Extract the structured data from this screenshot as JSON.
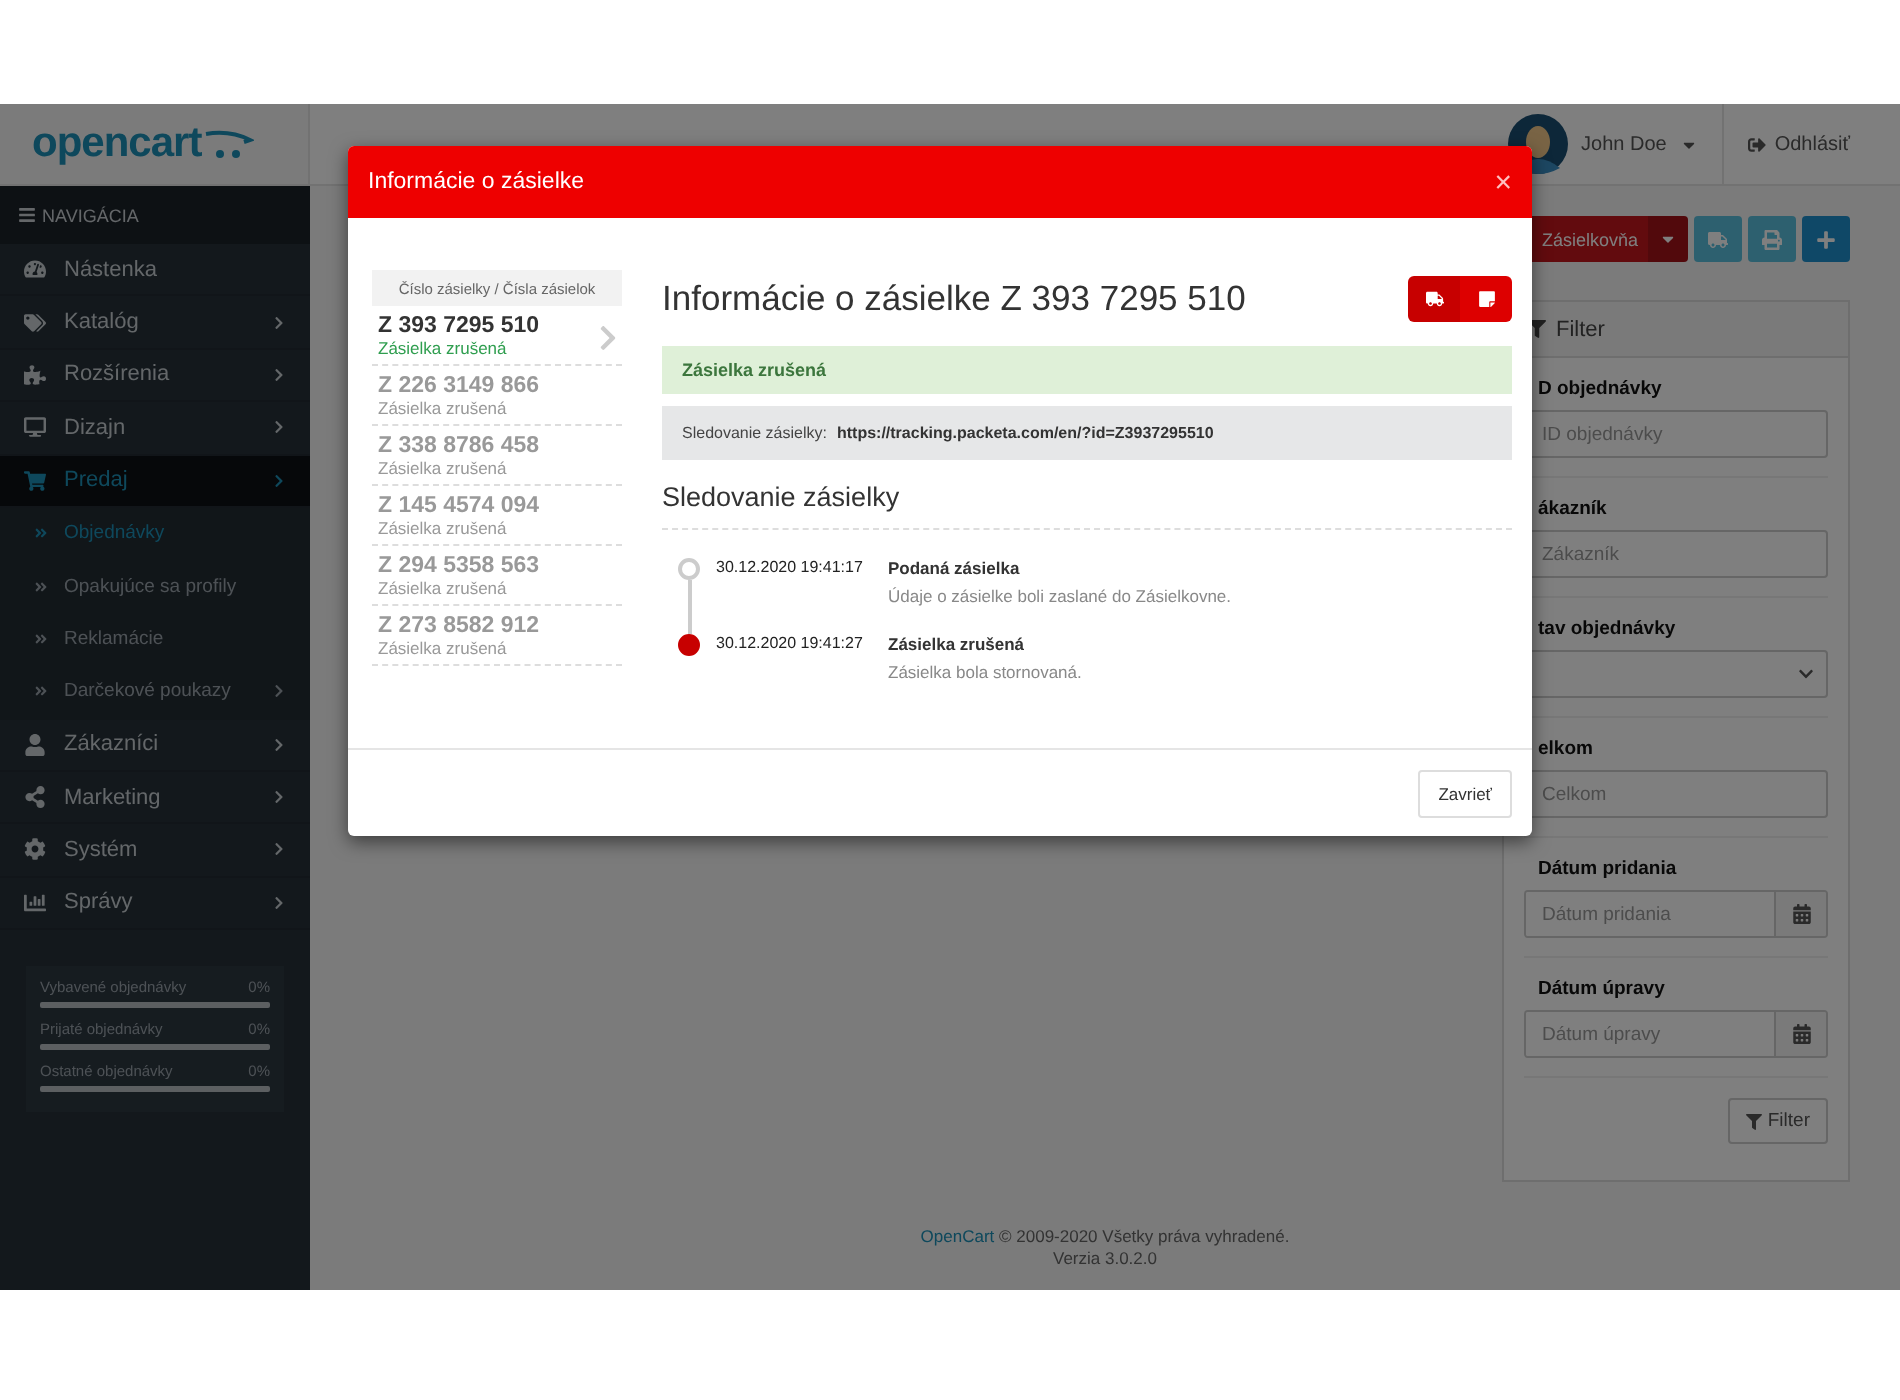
{
  "header": {
    "logo": "opencart",
    "user": "John Doe",
    "logout": "Odhlásiť"
  },
  "sidebar": {
    "title": "NAVIGÁCIA",
    "items": [
      {
        "label": "Nástenka",
        "submenu": false,
        "selected": false
      },
      {
        "label": "Katalóg",
        "submenu": true,
        "selected": false
      },
      {
        "label": "Rozšírenia",
        "submenu": true,
        "selected": false
      },
      {
        "label": "Dizajn",
        "submenu": true,
        "selected": false
      },
      {
        "label": "Predaj",
        "submenu": true,
        "selected": true,
        "expanded": true,
        "children": [
          {
            "label": "Objednávky",
            "submenu": false,
            "selected": true
          },
          {
            "label": "Opakujúce sa profily",
            "submenu": false,
            "selected": false
          },
          {
            "label": "Reklamácie",
            "submenu": false,
            "selected": false
          },
          {
            "label": "Darčekové poukazy",
            "submenu": true,
            "selected": false
          }
        ]
      },
      {
        "label": "Zákazníci",
        "submenu": true,
        "selected": false
      },
      {
        "label": "Marketing",
        "submenu": true,
        "selected": false
      },
      {
        "label": "Systém",
        "submenu": true,
        "selected": false
      },
      {
        "label": "Správy",
        "submenu": true,
        "selected": false
      }
    ],
    "stats": [
      {
        "label": "Vybavené objednávky",
        "value": "0%",
        "level": 0
      },
      {
        "label": "Prijaté objednávky",
        "value": "0%",
        "level": 0
      },
      {
        "label": "Ostatné objednávky",
        "value": "0%",
        "level": 0
      }
    ]
  },
  "toolbar": {
    "primary": "Zásielkovňa"
  },
  "filter": {
    "title": "Filter",
    "fields": [
      {
        "kind": "text",
        "label": "D objednávky",
        "placeholder": "ID objednávky"
      },
      {
        "kind": "text",
        "label": "ákazník",
        "placeholder": "Zákazník"
      },
      {
        "kind": "select",
        "label": "tav objednávky"
      },
      {
        "kind": "text",
        "label": "elkom",
        "placeholder": "Celkom"
      },
      {
        "kind": "date",
        "label": "Dátum pridania",
        "placeholder": "Dátum pridania"
      },
      {
        "kind": "date",
        "label": "Dátum úpravy",
        "placeholder": "Dátum úpravy"
      }
    ],
    "button": "Filter"
  },
  "footer": {
    "link": "OpenCart",
    "text": "© 2009-2020 Všetky práva vyhradené.",
    "version": "Verzia 3.0.2.0"
  },
  "modal": {
    "title": "Informácie o zásielke",
    "close": "×",
    "list_header": "Číslo zásielky / Čísla zásielok",
    "packets": [
      {
        "number": "Z 393 7295 510",
        "status": "Zásielka zrušená",
        "selected": true
      },
      {
        "number": "Z 226 3149 866",
        "status": "Zásielka zrušená",
        "selected": false
      },
      {
        "number": "Z 338 8786 458",
        "status": "Zásielka zrušená",
        "selected": false
      },
      {
        "number": "Z 145 4574 094",
        "status": "Zásielka zrušená",
        "selected": false
      },
      {
        "number": "Z 294 5358 563",
        "status": "Zásielka zrušená",
        "selected": false
      },
      {
        "number": "Z 273 8582 912",
        "status": "Zásielka zrušená",
        "selected": false
      }
    ],
    "heading": "Informácie o zásielke Z 393 7295 510",
    "alert": "Zásielka zrušená",
    "tracking_label": "Sledovanie zásielky:",
    "tracking_url": "https://tracking.packeta.com/en/?id=Z3937295510",
    "history_title": "Sledovanie zásielky",
    "events": [
      {
        "time": "30.12.2020 19:41:17",
        "title": "Podaná zásielka",
        "description": "Údaje o zásielke boli zaslané do Zásielkovne.",
        "current": false
      },
      {
        "time": "30.12.2020 19:41:27",
        "title": "Zásielka zrušená",
        "description": "Zásielka bola stornovaná.",
        "current": true
      }
    ],
    "close_button": "Zavrieť"
  }
}
